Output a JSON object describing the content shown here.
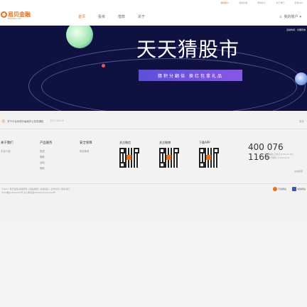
{
  "topbar": {
    "items": [
      "我的账户",
      "我的优惠",
      "帮助中心",
      "关于我们",
      "手机APP"
    ]
  },
  "header": {
    "logo_text": "易贝金融",
    "logo_sub": "Ebanker.com",
    "nav": [
      "首页",
      "投资",
      "借款",
      "关于"
    ],
    "login_label": "我的账户"
  },
  "banner": {
    "tag": "活动时间：长期有效",
    "title": "天天猜股市",
    "button_label": "猜积分翻倍 换红包拿礼品",
    "colors": {
      "bg": "#0f1140",
      "button": "#5b4fd8"
    }
  },
  "notice": {
    "text": "关于平台系统升级维护公告的通知",
    "date": "2017-05-19",
    "more_label": "更多"
  },
  "footer": {
    "columns": [
      {
        "heading": "关于我们",
        "items": [
          "平台介绍"
        ]
      },
      {
        "heading": "产品服务",
        "items": [
          "投资",
          "借款",
          "活动",
          "帮助"
        ]
      },
      {
        "heading": "安全保障",
        "items": [
          "风控体系"
        ]
      }
    ],
    "qrcodes": [
      {
        "heading": "关注微信"
      },
      {
        "heading": "关注微博"
      },
      {
        "heading": "下载APP"
      }
    ],
    "hotline": "400 076 1166",
    "hotline_sub": [
      "客服热线(工作日 9:00-21:00)",
      "周末及节假日 9:00-18:00"
    ],
    "online_label": "在线客服"
  },
  "copyright": {
    "line1": "©2017 易贝金融 版权所有 | 网站地图 | 友情链接 | 合作伙伴 | 联系我们",
    "line2": "沪ICP备XXXXXXXX号 沪公网安备XXXXXXXXXXXXX号"
  },
  "badges": [
    "可信网站",
    "诚信网站"
  ]
}
